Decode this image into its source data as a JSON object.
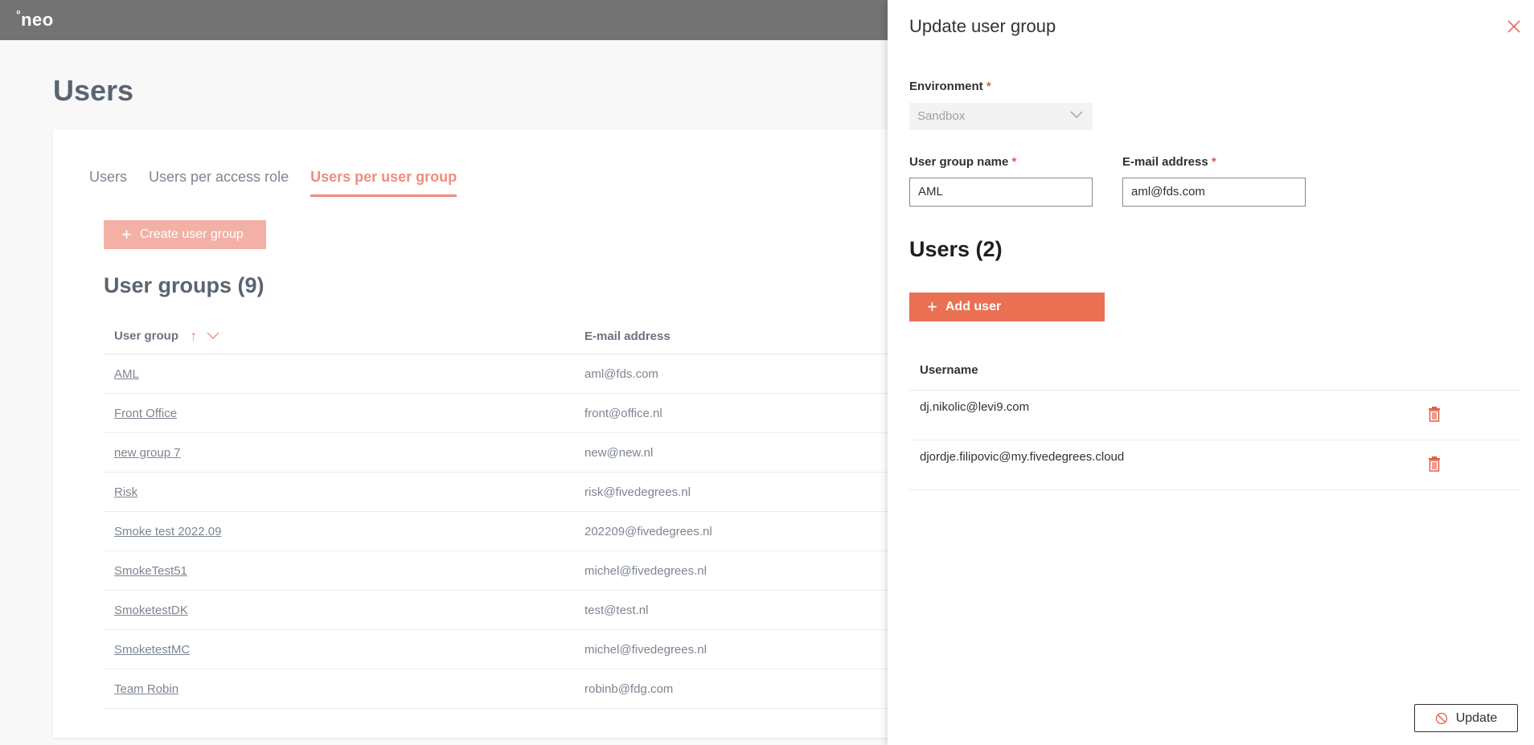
{
  "header": {
    "logo": "neo",
    "logo_deg": "°"
  },
  "page": {
    "title": "Users"
  },
  "tabs": [
    {
      "label": "Users"
    },
    {
      "label": "Users per access role"
    },
    {
      "label": "Users per user group"
    }
  ],
  "create_button": "Create user group",
  "groups": {
    "title": "User groups (9)",
    "col_group": "User group",
    "col_email": "E-mail address",
    "rows": [
      {
        "name": "AML",
        "email": "aml@fds.com"
      },
      {
        "name": "Front Office",
        "email": "front@office.nl"
      },
      {
        "name": "new group 7",
        "email": "new@new.nl"
      },
      {
        "name": "Risk",
        "email": "risk@fivedegrees.nl"
      },
      {
        "name": "Smoke test 2022.09",
        "email": "202209@fivedegrees.nl"
      },
      {
        "name": "SmokeTest51",
        "email": "michel@fivedegrees.nl"
      },
      {
        "name": "SmoketestDK",
        "email": "test@test.nl"
      },
      {
        "name": "SmoketestMC",
        "email": "michel@fivedegrees.nl"
      },
      {
        "name": "Team Robin",
        "email": "robinb@fdg.com"
      }
    ]
  },
  "panel": {
    "title": "Update user group",
    "environment_label": "Environment",
    "environment_value": "Sandbox",
    "group_name_label": "User group name",
    "group_name_value": "AML",
    "email_label": "E-mail address",
    "email_value": "aml@fds.com",
    "required_mark": "*",
    "users_title": "Users (2)",
    "add_user": "Add user",
    "username_header": "Username",
    "users": [
      {
        "username": "dj.nikolic@levi9.com"
      },
      {
        "username": "djordje.filipovic@my.fivedegrees.cloud"
      }
    ],
    "update_button": "Update"
  },
  "colors": {
    "accent": "#ef8d7e",
    "primary_button": "#e97052",
    "topbar": "#737373"
  }
}
